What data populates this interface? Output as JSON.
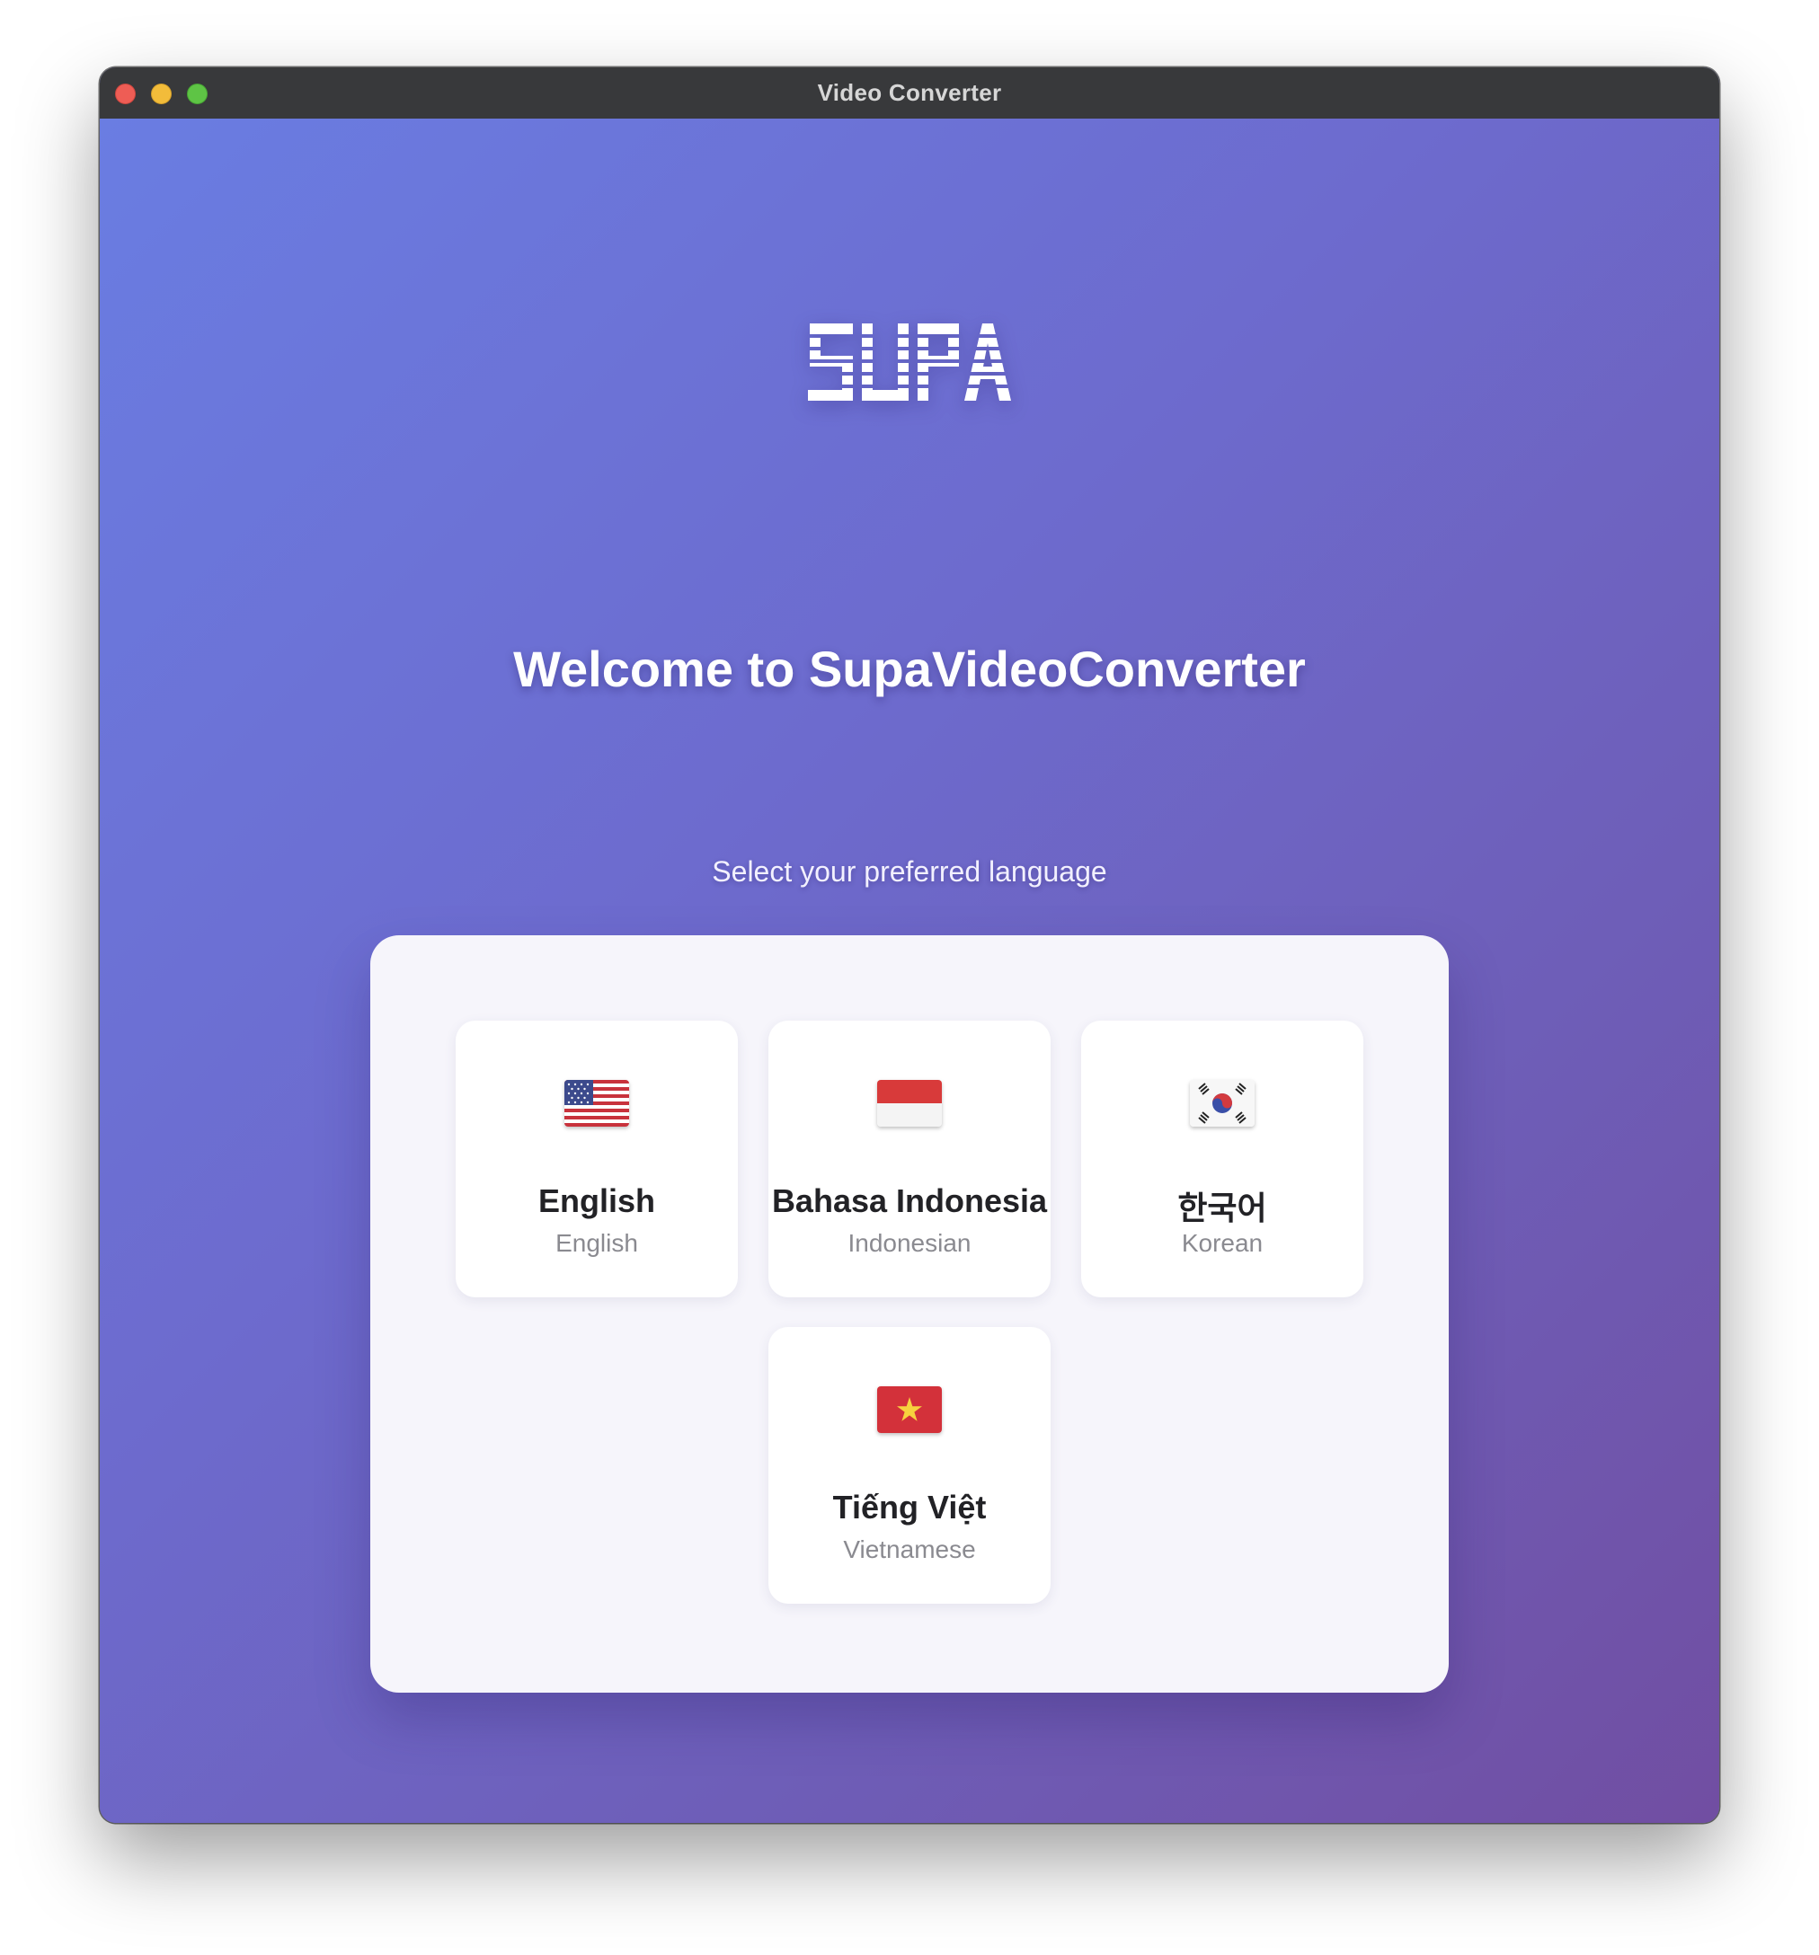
{
  "window": {
    "title": "Video Converter"
  },
  "logo": {
    "text": "SUPA"
  },
  "welcome": {
    "heading": "Welcome to SupaVideoConverter",
    "subtitle": "Select your preferred language"
  },
  "languages": [
    {
      "name": "English",
      "native": "English",
      "flag": "us-flag-icon"
    },
    {
      "name": "Bahasa Indonesia",
      "native": "Indonesian",
      "flag": "indonesia-flag-icon"
    },
    {
      "name": "한국어",
      "native": "Korean",
      "flag": "south-korea-flag-icon"
    },
    {
      "name": "Tiếng Việt",
      "native": "Vietnamese",
      "flag": "vietnam-flag-icon"
    }
  ],
  "colors": {
    "gradient_start": "#6a7de2",
    "gradient_end": "#714ea2",
    "titlebar": "#38393b",
    "panel": "#f6f5fb"
  }
}
